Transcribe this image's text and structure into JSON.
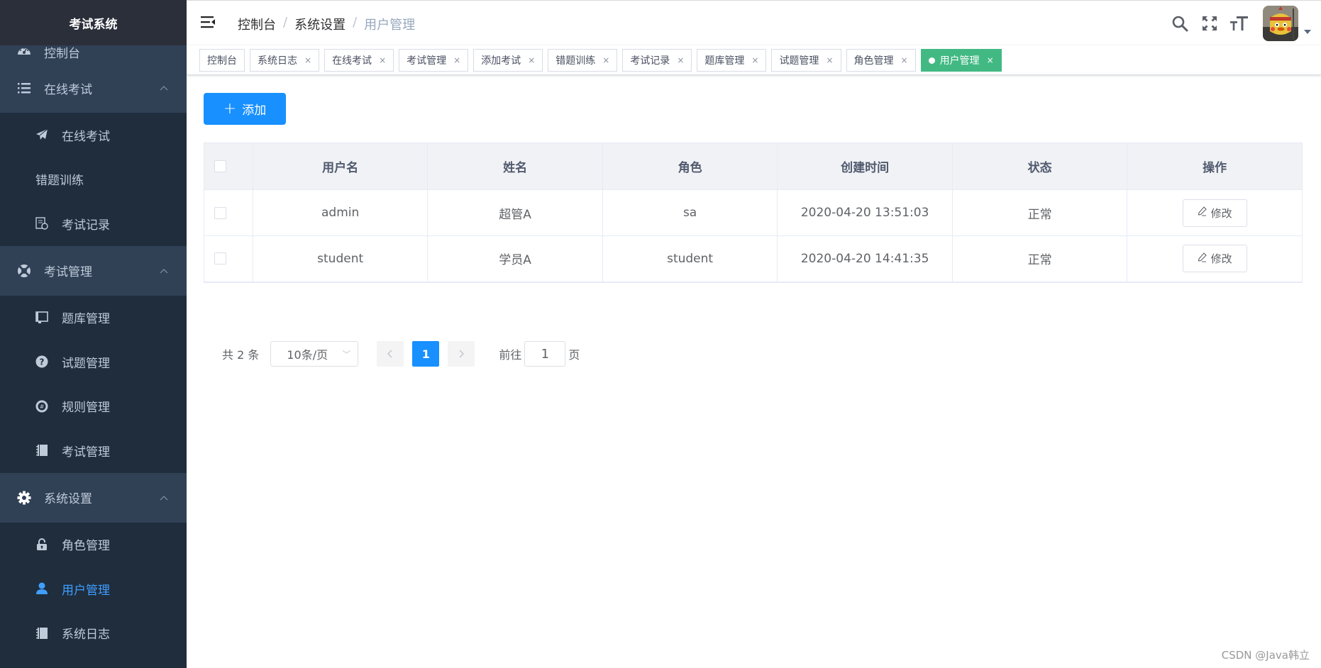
{
  "app": {
    "title": "考试系统"
  },
  "sidebar": {
    "items": [
      {
        "type": "top",
        "label": "控制台",
        "icon": "dashboard-icon",
        "partial": true
      },
      {
        "type": "top",
        "label": "在线考试",
        "icon": "list-icon",
        "expanded": true
      },
      {
        "type": "sub",
        "label": "在线考试",
        "icon": "paper-plane-icon"
      },
      {
        "type": "sub",
        "label": "错题训练",
        "icon": ""
      },
      {
        "type": "sub",
        "label": "考试记录",
        "icon": "record-icon"
      },
      {
        "type": "top",
        "label": "考试管理",
        "icon": "lifebuoy-icon",
        "expanded": true
      },
      {
        "type": "sub",
        "label": "题库管理",
        "icon": "book-icon"
      },
      {
        "type": "sub",
        "label": "试题管理",
        "icon": "question-icon"
      },
      {
        "type": "sub",
        "label": "规则管理",
        "icon": "rule-icon"
      },
      {
        "type": "sub",
        "label": "考试管理",
        "icon": "notebook-icon"
      },
      {
        "type": "top",
        "label": "系统设置",
        "icon": "gear-icon",
        "expanded": true
      },
      {
        "type": "sub",
        "label": "角色管理",
        "icon": "lock-icon"
      },
      {
        "type": "sub",
        "label": "用户管理",
        "icon": "user-icon",
        "active": true
      },
      {
        "type": "sub",
        "label": "系统日志",
        "icon": "notebook-icon"
      }
    ]
  },
  "header": {
    "breadcrumb": [
      "控制台",
      "系统设置",
      "用户管理"
    ],
    "icons": [
      "search-icon",
      "fullscreen-icon",
      "font-size-icon"
    ]
  },
  "tags": [
    {
      "label": "控制台",
      "closable": false
    },
    {
      "label": "系统日志",
      "closable": true
    },
    {
      "label": "在线考试",
      "closable": true
    },
    {
      "label": "考试管理",
      "closable": true
    },
    {
      "label": "添加考试",
      "closable": true
    },
    {
      "label": "错题训练",
      "closable": true
    },
    {
      "label": "考试记录",
      "closable": true
    },
    {
      "label": "题库管理",
      "closable": true
    },
    {
      "label": "试题管理",
      "closable": true
    },
    {
      "label": "角色管理",
      "closable": true
    },
    {
      "label": "用户管理",
      "closable": true,
      "active": true
    }
  ],
  "toolbar": {
    "add_label": "添加"
  },
  "table": {
    "columns": [
      "用户名",
      "姓名",
      "角色",
      "创建时间",
      "状态",
      "操作"
    ],
    "rows": [
      {
        "username": "admin",
        "name": "超管A",
        "role": "sa",
        "created": "2020-04-20 13:51:03",
        "status": "正常",
        "action": "修改"
      },
      {
        "username": "student",
        "name": "学员A",
        "role": "student",
        "created": "2020-04-20 14:41:35",
        "status": "正常",
        "action": "修改"
      }
    ]
  },
  "pagination": {
    "total_label": "共 2 条",
    "page_size": "10条/页",
    "current_page": "1",
    "jump_prefix": "前往",
    "jump_value": "1",
    "jump_suffix": "页"
  },
  "watermark": "CSDN @Java韩立",
  "colors": {
    "primary": "#1890ff",
    "active_tag": "#42b983",
    "sidebar_bg": "#304156",
    "submenu_bg": "#1f2d3d",
    "active_menu": "#409eff"
  }
}
